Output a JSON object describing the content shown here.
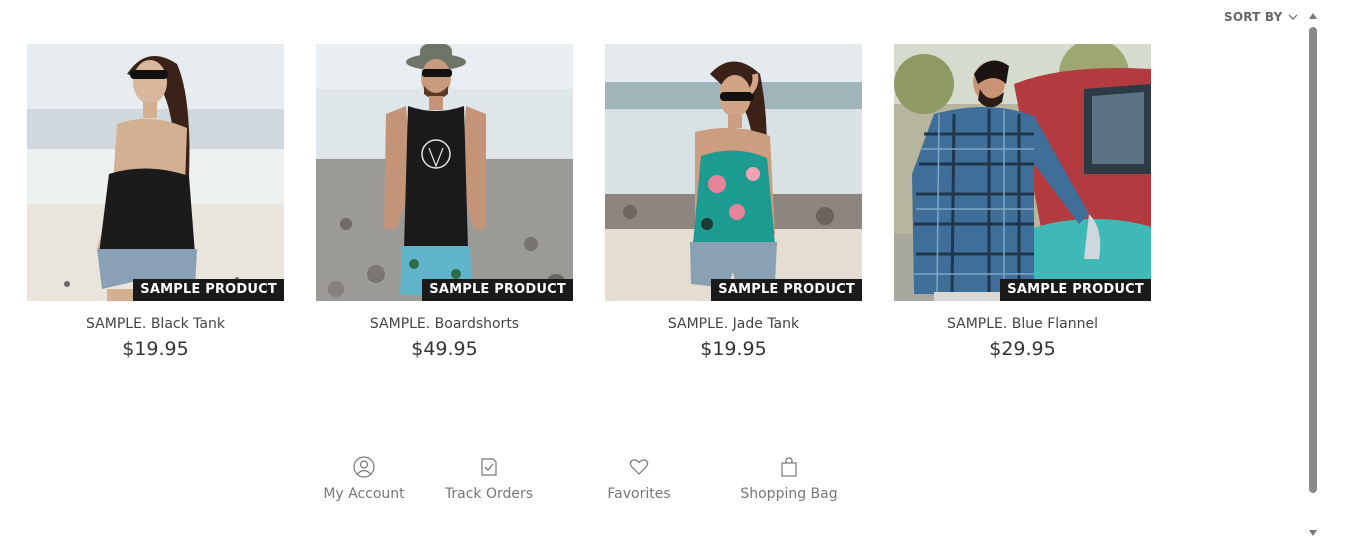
{
  "sort": {
    "label": "SORT BY",
    "icon": "chevron-down-icon"
  },
  "products": [
    {
      "name": "SAMPLE. Black Tank",
      "price": "$19.95",
      "badge": "SAMPLE PRODUCT"
    },
    {
      "name": "SAMPLE. Boardshorts",
      "price": "$49.95",
      "badge": "SAMPLE PRODUCT"
    },
    {
      "name": "SAMPLE. Jade Tank",
      "price": "$19.95",
      "badge": "SAMPLE PRODUCT"
    },
    {
      "name": "SAMPLE. Blue Flannel",
      "price": "$29.95",
      "badge": "SAMPLE PRODUCT"
    }
  ],
  "footer_nav": [
    {
      "label": "My Account",
      "icon": "user-icon"
    },
    {
      "label": "Track Orders",
      "icon": "order-check-icon"
    },
    {
      "label": "Favorites",
      "icon": "heart-icon"
    },
    {
      "label": "Shopping Bag",
      "icon": "shopping-bag-icon"
    }
  ]
}
